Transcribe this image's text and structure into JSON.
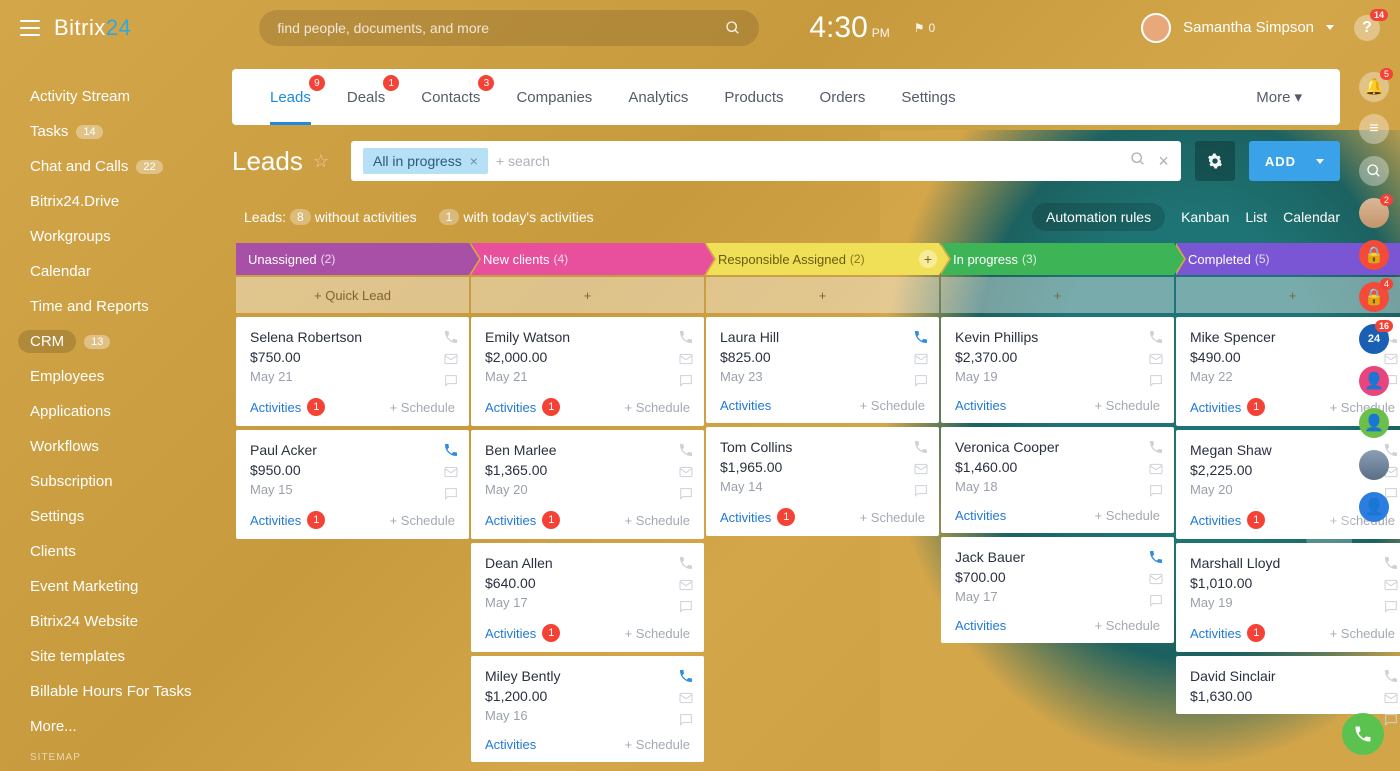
{
  "brand": {
    "a": "Bitrix",
    "b": "24"
  },
  "search_placeholder": "find people, documents, and more",
  "clock": {
    "time": "4:30",
    "ampm": "PM"
  },
  "flag_count": "0",
  "user": {
    "name": "Samantha Simpson"
  },
  "help_badge": "14",
  "sidebar": {
    "items": [
      {
        "label": "Activity Stream"
      },
      {
        "label": "Tasks",
        "badge": "14"
      },
      {
        "label": "Chat and Calls",
        "badge": "22"
      },
      {
        "label": "Bitrix24.Drive"
      },
      {
        "label": "Workgroups"
      },
      {
        "label": "Calendar"
      },
      {
        "label": "Time and Reports"
      },
      {
        "label": "CRM",
        "badge": "13",
        "active": true
      },
      {
        "label": "Employees"
      },
      {
        "label": "Applications"
      },
      {
        "label": "Workflows"
      },
      {
        "label": "Subscription"
      },
      {
        "label": "Settings"
      },
      {
        "label": "Clients"
      },
      {
        "label": "Event Marketing"
      },
      {
        "label": "Bitrix24 Website"
      },
      {
        "label": "Site templates"
      },
      {
        "label": "Billable Hours For Tasks"
      },
      {
        "label": "More..."
      }
    ],
    "sitemap": "SITEMAP"
  },
  "tabs": [
    {
      "label": "Leads",
      "badge": "9",
      "active": true
    },
    {
      "label": "Deals",
      "badge": "1"
    },
    {
      "label": "Contacts",
      "badge": "3"
    },
    {
      "label": "Companies"
    },
    {
      "label": "Analytics"
    },
    {
      "label": "Products"
    },
    {
      "label": "Orders"
    },
    {
      "label": "Settings"
    }
  ],
  "tabs_more": "More",
  "page_title": "Leads",
  "filter_chip": "All in progress",
  "filter_placeholder": "+ search",
  "add_label": "ADD",
  "subbar": {
    "leads_label": "Leads:",
    "without_cnt": "8",
    "without_text": "without activities",
    "today_cnt": "1",
    "today_text": "with today's activities"
  },
  "views": {
    "auto": "Automation rules",
    "kanban": "Kanban",
    "list": "List",
    "calendar": "Calendar"
  },
  "quick_lead": "Quick Lead",
  "schedule": "+ Schedule",
  "activities": "Activities",
  "columns": [
    {
      "title": "Unassigned",
      "count": "(2)",
      "color": "#a84fa8",
      "cards": [
        {
          "name": "Selena Robertson",
          "amount": "$750.00",
          "date": "May 21",
          "act": "1"
        },
        {
          "name": "Paul Acker",
          "amount": "$950.00",
          "date": "May 15",
          "act": "1",
          "blue": true
        }
      ]
    },
    {
      "title": "New clients",
      "count": "(4)",
      "color": "#e84f9c",
      "cards": [
        {
          "name": "Emily Watson",
          "amount": "$2,000.00",
          "date": "May 21",
          "act": "1"
        },
        {
          "name": "Ben Marlee",
          "amount": "$1,365.00",
          "date": "May 20",
          "act": "1"
        },
        {
          "name": "Dean Allen",
          "amount": "$640.00",
          "date": "May 17",
          "act": "1"
        },
        {
          "name": "Miley Bently",
          "amount": "$1,200.00",
          "date": "May 16",
          "blue": true
        }
      ]
    },
    {
      "title": "Responsible Assigned",
      "count": "(2)",
      "color": "#f0e057",
      "text": "#6a5a10",
      "cards": [
        {
          "name": "Laura Hill",
          "amount": "$825.00",
          "date": "May 23",
          "blue": true
        },
        {
          "name": "Tom Collins",
          "amount": "$1,965.00",
          "date": "May 14",
          "act": "1"
        }
      ]
    },
    {
      "title": "In progress",
      "count": "(3)",
      "color": "#3db556",
      "cards": [
        {
          "name": "Kevin Phillips",
          "amount": "$2,370.00",
          "date": "May 19"
        },
        {
          "name": "Veronica Cooper",
          "amount": "$1,460.00",
          "date": "May 18"
        },
        {
          "name": "Jack Bauer",
          "amount": "$700.00",
          "date": "May 17",
          "blue": true
        }
      ]
    },
    {
      "title": "Completed",
      "count": "(5)",
      "color": "#7a55d4",
      "cards": [
        {
          "name": "Mike Spencer",
          "amount": "$490.00",
          "date": "May 22",
          "act": "1"
        },
        {
          "name": "Megan Shaw",
          "amount": "$2,225.00",
          "date": "May 20",
          "act": "1"
        },
        {
          "name": "Marshall Lloyd",
          "amount": "$1,010.00",
          "date": "May 19",
          "act": "1"
        },
        {
          "name": "David Sinclair",
          "amount": "$1,630.00"
        }
      ]
    }
  ],
  "rail": {
    "bell": "5",
    "lock2": "4",
    "b24": "16"
  }
}
